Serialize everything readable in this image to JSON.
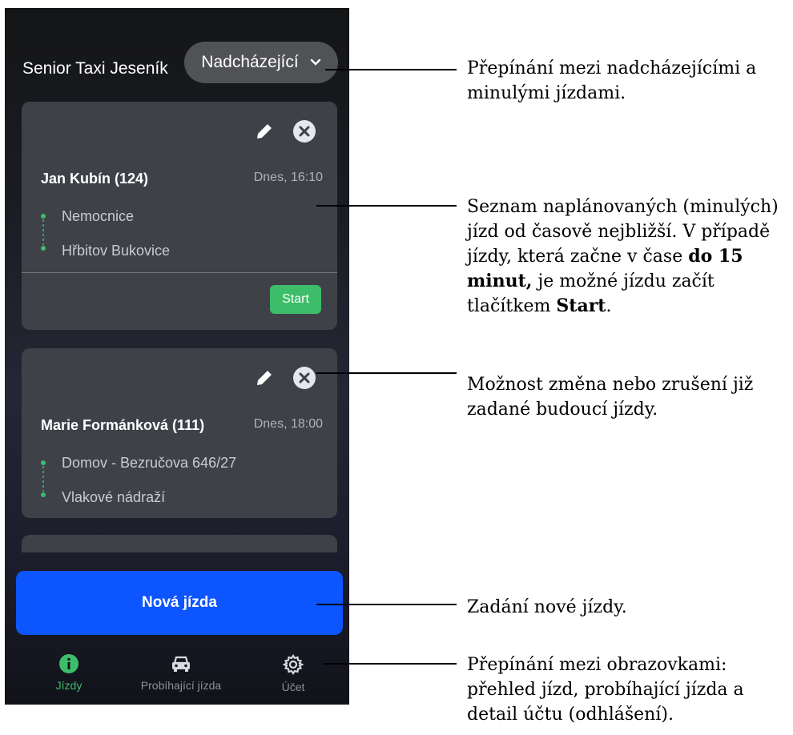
{
  "app": {
    "title": "Senior Taxi Jeseník",
    "filter": "Nadcházející",
    "new_ride_label": "Nová jízda",
    "accent_green": "#3dbd6a",
    "accent_blue": "#0d55ff"
  },
  "rides": [
    {
      "passenger": "Jan Kubín (124)",
      "time": "Dnes, 16:10",
      "from": "Nemocnice",
      "to": "Hřbitov Bukovice",
      "start_label": "Start"
    },
    {
      "passenger": "Marie Formánková (111)",
      "time": "Dnes, 18:00",
      "from": "Domov - Bezručova 646/27",
      "to": "Vlakové nádraží"
    }
  ],
  "tabs": [
    {
      "label": "Jízdy",
      "icon": "info-icon",
      "active": true
    },
    {
      "label": "Probíhající jízda",
      "icon": "car-icon",
      "active": false
    },
    {
      "label": "Účet",
      "icon": "gear-icon",
      "active": false
    }
  ],
  "annotations": {
    "filter_note": "Přepínání mezi nadcházejícími a minulými jízdami.",
    "list_note_1": "Seznam naplánovaných (minulých) jízd od časově nejbližší. V případě jízdy, která začne v čase ",
    "list_note_bold": "do 15 minut,",
    "list_note_2": " je možné jízdu začít tlačítkem ",
    "list_note_start": "Start",
    "list_note_end": ".",
    "edit_note": "Možnost změna nebo zrušení již zadané budoucí jízdy.",
    "new_ride_note": "Zadání nové jízdy.",
    "tabs_note": "Přepínání mezi obrazovkami: přehled jízd, probíhající jízda a detail účtu (odhlášení)."
  }
}
